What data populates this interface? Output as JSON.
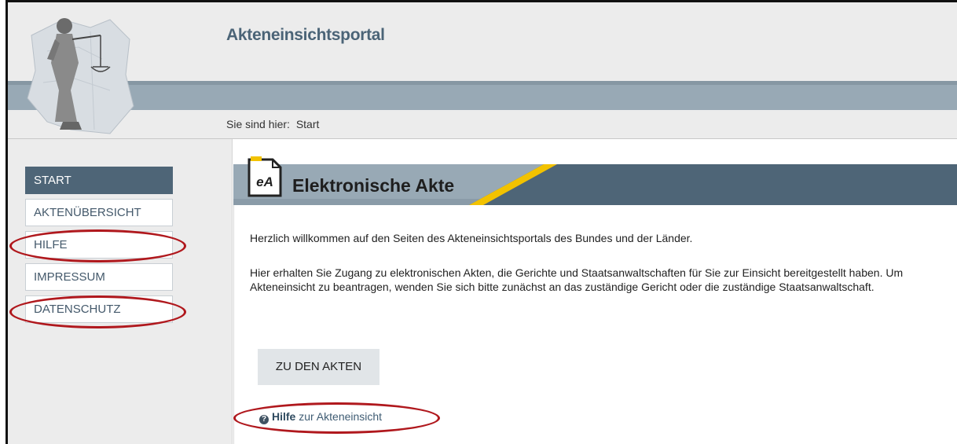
{
  "header": {
    "portal_title": "Akteneinsichtsportal",
    "breadcrumb_prefix": "Sie sind hier:",
    "breadcrumb_current": "Start"
  },
  "sidebar": {
    "items": [
      {
        "label": "START",
        "active": true
      },
      {
        "label": "AKTENÜBERSICHT",
        "active": false
      },
      {
        "label": "HILFE",
        "active": false
      },
      {
        "label": "IMPRESSUM",
        "active": false
      },
      {
        "label": "DATENSCHUTZ",
        "active": false
      }
    ]
  },
  "main": {
    "section_icon_label": "eA",
    "section_title": "Elektronische Akte",
    "welcome_text": "Herzlich willkommen auf den Seiten des Akteneinsichtsportals des Bundes und der Länder.",
    "info_text": "Hier erhalten Sie Zugang zu elektronischen Akten, die Gerichte und Staatsanwaltschaften für Sie zur Einsicht bereitgestellt haben. Um Akteneinsicht zu beantragen, wenden Sie sich bitte zunächst an das zuständige Gericht oder die zuständige Staatsanwaltschaft.",
    "akten_button": "ZU DEN AKTEN",
    "help_icon": "?",
    "help_link_bold": "Hilfe",
    "help_link_rest": "zur Akteneinsicht"
  },
  "colors": {
    "accent_dark": "#4e6577",
    "accent_yellow": "#f2c200",
    "annotation_red": "#b0181d"
  }
}
